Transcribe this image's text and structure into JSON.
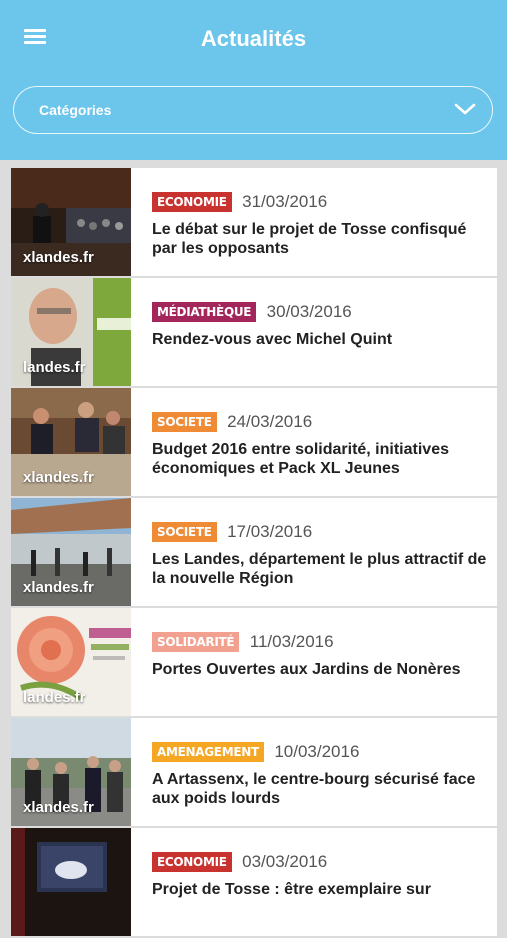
{
  "header": {
    "title": "Actualités",
    "menu_icon": "hamburger-menu-icon",
    "background": "#6cc5ea"
  },
  "filter": {
    "label": "Catégories",
    "icon": "chevron-down-icon"
  },
  "articles": [
    {
      "category": "ECONOMIE",
      "category_color": "#c8332f",
      "date": "31/03/2016",
      "title": "Le débat sur le projet de Tosse confisqué par les opposants",
      "thumb_text": "xlandes.fr"
    },
    {
      "category": "MÉDIATHÈQUE",
      "category_color": "#a3265b",
      "date": "30/03/2016",
      "title": "Rendez-vous avec Michel Quint",
      "thumb_text": "landes.fr"
    },
    {
      "category": "SOCIETE",
      "category_color": "#ef8a35",
      "date": "24/03/2016",
      "title": "Budget 2016 entre solidarité, initiatives économiques et Pack XL Jeunes",
      "thumb_text": "xlandes.fr"
    },
    {
      "category": "SOCIETE",
      "category_color": "#ef8a35",
      "date": "17/03/2016",
      "title": "Les Landes, département le plus attractif de la nouvelle Région",
      "thumb_text": "xlandes.fr"
    },
    {
      "category": "SOLIDARITÉ",
      "category_color": "#f2a08f",
      "date": "11/03/2016",
      "title": "Portes Ouvertes aux Jardins de Nonères",
      "thumb_text": "landes.fr"
    },
    {
      "category": "AMENAGEMENT",
      "category_color": "#f5a623",
      "date": "10/03/2016",
      "title": "A Artassenx, le centre-bourg sécurisé face aux poids lourds",
      "thumb_text": "xlandes.fr"
    },
    {
      "category": "ECONOMIE",
      "category_color": "#c8332f",
      "date": "03/03/2016",
      "title": "Projet de Tosse : être exemplaire sur",
      "thumb_text": ""
    }
  ]
}
